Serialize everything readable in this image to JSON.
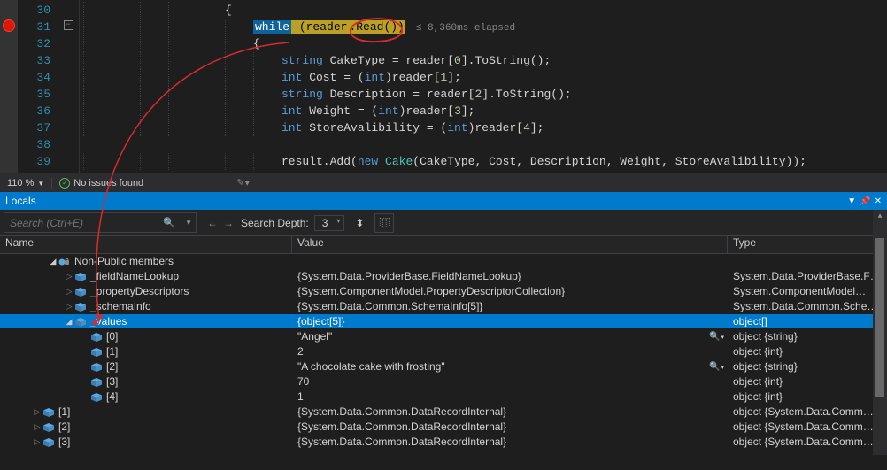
{
  "code": {
    "lines": [
      30,
      31,
      32,
      33,
      34,
      35,
      36,
      37,
      38,
      39
    ],
    "while_kw": "while",
    "reader_ident": "reader",
    "read_call": ".Read())",
    "perf_tip_text": "≤ 8,360ms elapsed",
    "line30": "{",
    "line32": "{",
    "line33_a": "string",
    "line33_b": " CakeType = reader[",
    "line33_c": "0",
    "line33_d": "].ToString();",
    "line34_a": "int",
    "line34_b": " Cost = (",
    "line34_c": "int",
    "line34_d": ")reader[",
    "line34_e": "1",
    "line34_f": "];",
    "line35_a": "string",
    "line35_b": " Description = reader[",
    "line35_c": "2",
    "line35_d": "].ToString();",
    "line36_a": "int",
    "line36_b": " Weight = (",
    "line36_c": "int",
    "line36_d": ")reader[",
    "line36_e": "3",
    "line36_f": "];",
    "line37_a": "int",
    "line37_b": " StoreAvalibility = (",
    "line37_c": "int",
    "line37_d": ")reader[",
    "line37_e": "4",
    "line37_f": "];",
    "line39_a": "result.Add(",
    "line39_b": "new",
    "line39_c": " ",
    "line39_d": "Cake",
    "line39_e": "(CakeType, Cost, Description, Weight, StoreAvalibility));"
  },
  "status": {
    "zoom": "110 %",
    "issues": "No issues found"
  },
  "panel": {
    "title": "Locals"
  },
  "search": {
    "placeholder": "Search (Ctrl+E)",
    "depth_label": "Search Depth:",
    "depth_value": "3"
  },
  "columns": {
    "name": "Name",
    "value": "Value",
    "type": "Type"
  },
  "tree": [
    {
      "depth": 3,
      "exp": "▣",
      "icon": "lock",
      "name": "Non-Public members",
      "value": "",
      "type": ""
    },
    {
      "depth": 4,
      "exp": "▸",
      "icon": "field",
      "name": "_fieldNameLookup",
      "value": "{System.Data.ProviderBase.FieldNameLookup}",
      "type": "System.Data.ProviderBase.F…"
    },
    {
      "depth": 4,
      "exp": "▸",
      "icon": "field",
      "name": "_propertyDescriptors",
      "value": "{System.ComponentModel.PropertyDescriptorCollection}",
      "type": "System.ComponentModel…"
    },
    {
      "depth": 4,
      "exp": "▸",
      "icon": "field",
      "name": "_schemaInfo",
      "value": "{System.Data.Common.SchemaInfo[5]}",
      "type": "System.Data.Common.Sche…"
    },
    {
      "depth": 4,
      "exp": "▣",
      "icon": "field",
      "name": "_values",
      "value": "{object[5]}",
      "type": "object[]",
      "selected": true
    },
    {
      "depth": 5,
      "exp": "",
      "icon": "field",
      "name": "[0]",
      "value": "\"Angel\"",
      "type": "object {string}",
      "mag": true
    },
    {
      "depth": 5,
      "exp": "",
      "icon": "field",
      "name": "[1]",
      "value": "2",
      "type": "object {int}"
    },
    {
      "depth": 5,
      "exp": "",
      "icon": "field",
      "name": "[2]",
      "value": "\"A chocolate cake with frosting\"",
      "type": "object {string}",
      "mag": true
    },
    {
      "depth": 5,
      "exp": "",
      "icon": "field",
      "name": "[3]",
      "value": "70",
      "type": "object {int}"
    },
    {
      "depth": 5,
      "exp": "",
      "icon": "field",
      "name": "[4]",
      "value": "1",
      "type": "object {int}"
    },
    {
      "depth": 2,
      "exp": "▸",
      "icon": "field",
      "name": "[1]",
      "value": "{System.Data.Common.DataRecordInternal}",
      "type": "object {System.Data.Comm…"
    },
    {
      "depth": 2,
      "exp": "▸",
      "icon": "field",
      "name": "[2]",
      "value": "{System.Data.Common.DataRecordInternal}",
      "type": "object {System.Data.Comm…"
    },
    {
      "depth": 2,
      "exp": "▸",
      "icon": "field",
      "name": "[3]",
      "value": "{System.Data.Common.DataRecordInternal}",
      "type": "object {System.Data.Comm…"
    }
  ]
}
